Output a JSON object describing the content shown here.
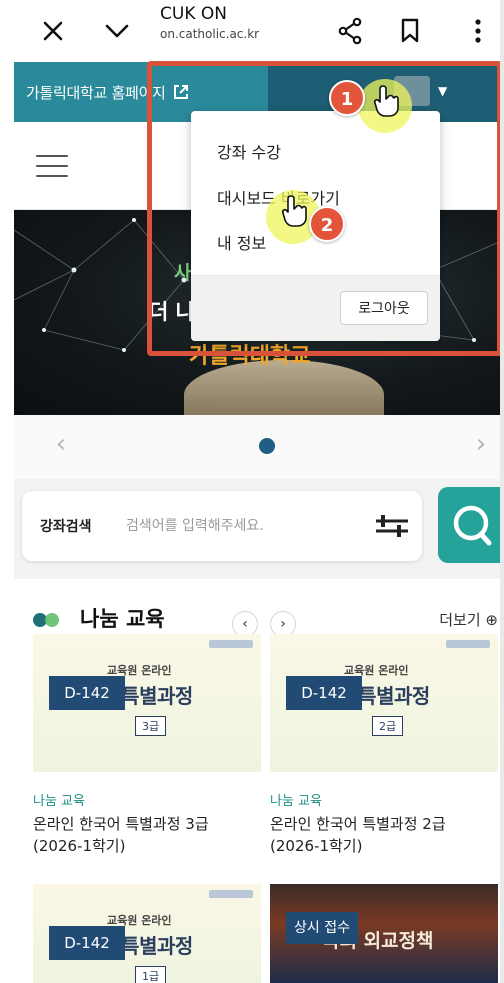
{
  "browser": {
    "title": "CUK ON",
    "host": "on.catholic.ac.kr"
  },
  "banner": {
    "homepage_link": "가톨릭대학교 홈페이지"
  },
  "hero": {
    "line1": "사",
    "line2": "더 나",
    "line3": "가톨릭대학교"
  },
  "dropdown": {
    "items": [
      "강좌 수강",
      "대시보드 바로가기",
      "내 정보"
    ],
    "logout": "로그아웃"
  },
  "search": {
    "label": "강좌검색",
    "placeholder": "검색어를 입력해주세요."
  },
  "section": {
    "title": "나눔 교육",
    "more": "더보기 ⊕"
  },
  "cards": [
    {
      "dday": "D-142",
      "banner": "교육원 온라인",
      "thumb_title": "한국어 특별과정",
      "level": "3급",
      "category": "나눔 교육",
      "title_line1": "온라인 한국어 특별과정 3급",
      "title_line2": "(2026-1학기)"
    },
    {
      "dday": "D-142",
      "banner": "교육원 온라인",
      "thumb_title": "한국어 특별과정",
      "level": "2급",
      "category": "나눔 교육",
      "title_line1": "온라인 한국어 특별과정 2급",
      "title_line2": "(2026-1학기)"
    },
    {
      "dday": "D-142",
      "banner": "교육원 온라인",
      "thumb_title": "한국어 특별과정",
      "level": "1급"
    },
    {
      "tag": "상시 접수",
      "thumb_title": "국의 외교정책"
    }
  ],
  "annotations": {
    "step1": "1",
    "step2": "2"
  },
  "colors": {
    "annotation": "#d9533b",
    "banner": "#1f6d7e",
    "accent": "#25a39b",
    "dday": "#214a75"
  }
}
